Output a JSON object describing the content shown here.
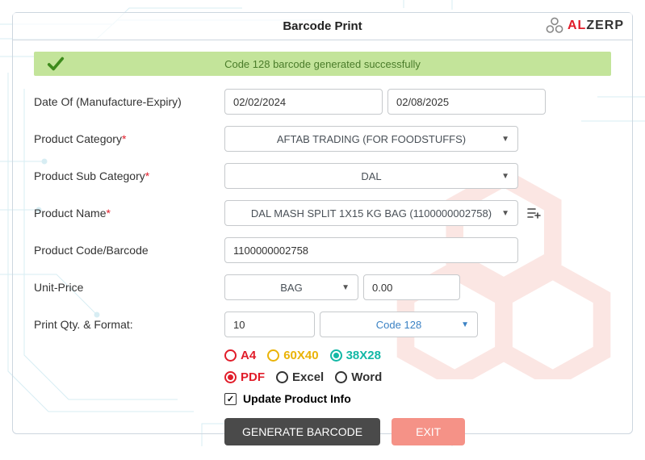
{
  "header": {
    "title": "Barcode Print",
    "logo_al": "AL",
    "logo_zerp": "ZERP"
  },
  "success_message": "Code 128 barcode generated successfully",
  "labels": {
    "date_of": "Date Of (Manufacture-Expiry)",
    "category": "Product Category",
    "subcategory": "Product Sub Category",
    "product_name": "Product Name",
    "code": "Product Code/Barcode",
    "unit_price": "Unit-Price",
    "qty_format": "Print Qty. & Format:",
    "asterisk": "*"
  },
  "fields": {
    "date_mfg": "02/02/2024",
    "date_exp": "02/08/2025",
    "category": "AFTAB TRADING (FOR FOODSTUFFS)",
    "subcategory": "DAL",
    "product_name": "DAL MASH SPLIT 1X15 KG BAG (1100000002758)",
    "code": "1100000002758",
    "unit": "BAG",
    "price": "0.00",
    "qty": "10",
    "format": "Code 128"
  },
  "size_options": {
    "a4": "A4",
    "s60": "60X40",
    "s38": "38X28"
  },
  "output_options": {
    "pdf": "PDF",
    "excel": "Excel",
    "word": "Word"
  },
  "update_info": "Update Product Info",
  "buttons": {
    "generate": "GENERATE BARCODE",
    "exit": "EXIT"
  }
}
